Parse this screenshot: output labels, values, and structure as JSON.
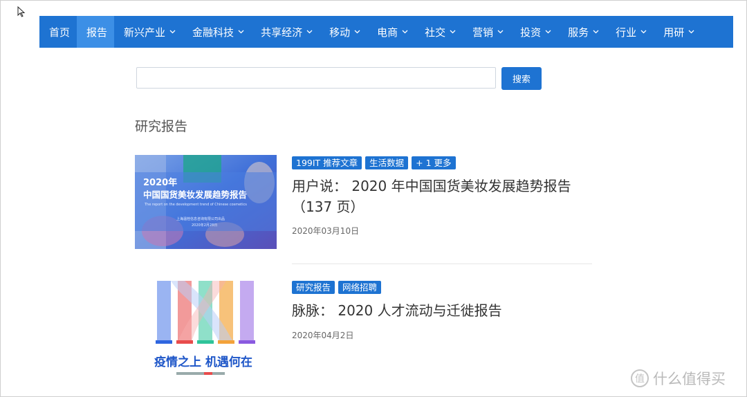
{
  "nav": {
    "items": [
      {
        "label": "首页",
        "dropdown": false,
        "active": false
      },
      {
        "label": "报告",
        "dropdown": false,
        "active": true
      },
      {
        "label": "新兴产业",
        "dropdown": true,
        "active": false
      },
      {
        "label": "金融科技",
        "dropdown": true,
        "active": false
      },
      {
        "label": "共享经济",
        "dropdown": true,
        "active": false
      },
      {
        "label": "移动",
        "dropdown": true,
        "active": false
      },
      {
        "label": "电商",
        "dropdown": true,
        "active": false
      },
      {
        "label": "社交",
        "dropdown": true,
        "active": false
      },
      {
        "label": "营销",
        "dropdown": true,
        "active": false
      },
      {
        "label": "投资",
        "dropdown": true,
        "active": false
      },
      {
        "label": "服务",
        "dropdown": true,
        "active": false
      },
      {
        "label": "行业",
        "dropdown": true,
        "active": false
      },
      {
        "label": "用研",
        "dropdown": true,
        "active": false
      }
    ]
  },
  "search": {
    "value": "",
    "placeholder": "",
    "button_label": "搜索"
  },
  "section_title": "研究报告",
  "posts": [
    {
      "tags": [
        "199IT 推荐文章",
        "生活数据",
        "+ 1 更多"
      ],
      "title": "用户说： 2020 年中国国货美妆发展趋势报告（137 页）",
      "date": "2020年03月10日",
      "thumb": {
        "year": "2020年",
        "headline": "中国国货美妆发展趋势报告",
        "subtitle": "The report on the development trend of Chinese cosmetics",
        "publisher": "上海温桂信息咨询有限公司出品",
        "pub_date": "2020年2月28日"
      }
    },
    {
      "tags": [
        "研究报告",
        "网络招聘"
      ],
      "title": "脉脉： 2020 人才流动与迁徙报告",
      "date": "2020年04月2日",
      "thumb": {
        "headline": "疫情之上 机遇何在"
      }
    }
  ],
  "watermark": {
    "text": "什么值得买",
    "icon": "zhi-logo-icon",
    "icon_char": "值"
  },
  "colors": {
    "nav_bg": "#1e73d2",
    "nav_active": "#3c8fe6",
    "tag_bg": "#1e73d2"
  }
}
